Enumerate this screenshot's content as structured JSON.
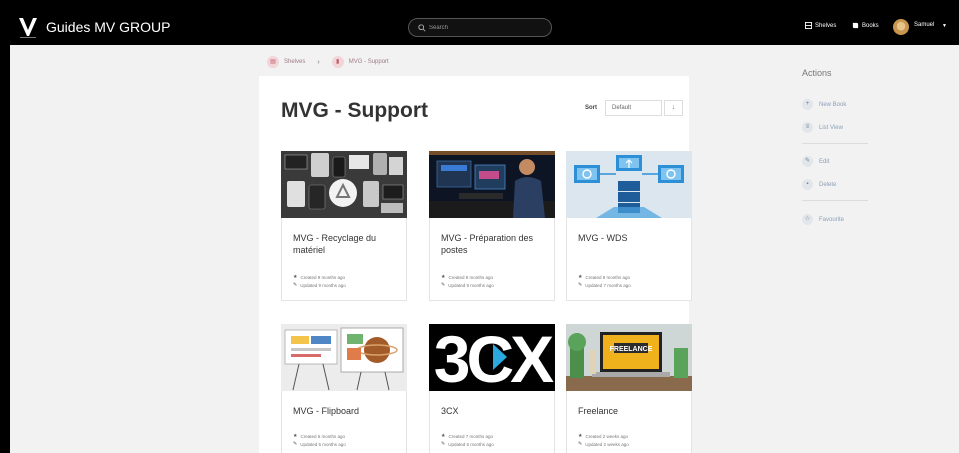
{
  "header": {
    "brand": "Guides MV GROUP",
    "search_placeholder": "Search",
    "nav": [
      {
        "icon": "shelves-icon",
        "label": "Shelves"
      },
      {
        "icon": "books-icon",
        "label": "Books"
      }
    ],
    "user": {
      "name": "Samuel"
    }
  },
  "breadcrumb": [
    {
      "icon": "shelves-icon",
      "label": "Shelves"
    },
    {
      "icon": "book-icon",
      "label": "MVG - Support"
    }
  ],
  "page": {
    "title": "MVG - Support",
    "sort": {
      "label": "Sort",
      "value": "Default",
      "direction_icon": "↓"
    }
  },
  "books": [
    {
      "name": "MVG - Recyclage du matériel",
      "created": "Created 9 months ago",
      "updated": "Updated 9 months ago",
      "thumb": "recycling-devices"
    },
    {
      "name": "MVG - Préparation des postes",
      "created": "Created 9 months ago",
      "updated": "Updated 9 months ago",
      "thumb": "workstation"
    },
    {
      "name": "MVG - WDS",
      "created": "Created 9 months ago",
      "updated": "Updated 7 months ago",
      "thumb": "wds-server"
    },
    {
      "name": "MVG - Flipboard",
      "created": "Created 6 months ago",
      "updated": "Updated 5 months ago",
      "thumb": "flipboard"
    },
    {
      "name": "3CX",
      "created": "Created 7 months ago",
      "updated": "Updated 5 months ago",
      "thumb": "3cx-logo"
    },
    {
      "name": "Freelance",
      "created": "Created 2 weeks ago",
      "updated": "Updated 2 weeks ago",
      "thumb": "freelance-laptop"
    }
  ],
  "thumb_texts": {
    "cx": "3CX",
    "freelance": "FREELANCE"
  },
  "actions": {
    "title": "Actions",
    "items": [
      {
        "icon": "plus-icon",
        "label": "New Book"
      },
      {
        "icon": "list-icon",
        "label": "List View"
      },
      {
        "icon": "edit-icon",
        "label": "Edit"
      },
      {
        "icon": "delete-icon",
        "label": "Delete"
      },
      {
        "icon": "star-icon",
        "label": "Favourite"
      }
    ]
  },
  "colors": {
    "header_bg": "#000000",
    "accent": "#c25b6b",
    "action_text": "#8aa0b8"
  }
}
